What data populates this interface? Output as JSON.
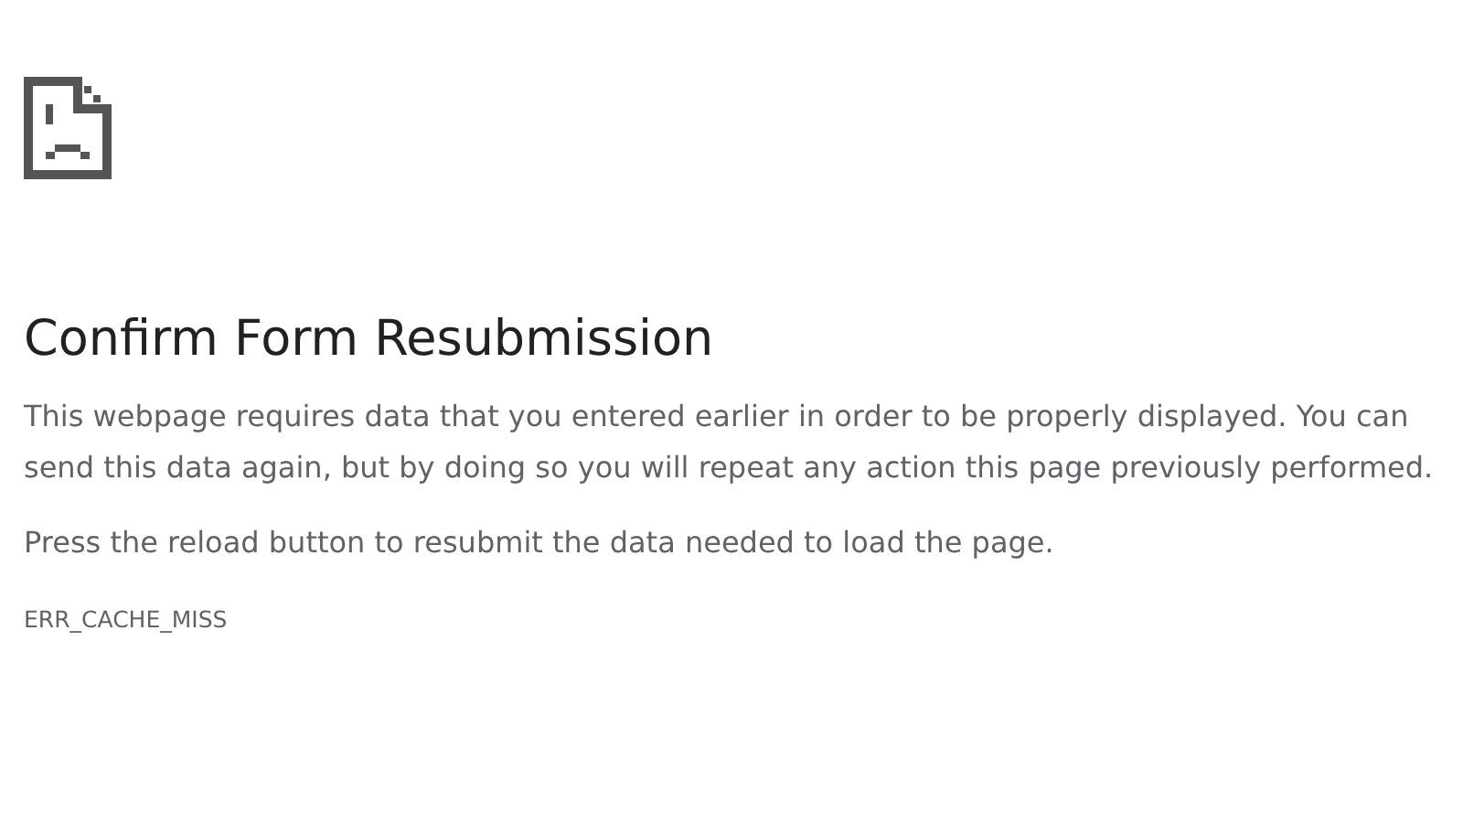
{
  "heading": "Confirm Form Resubmission",
  "paragraphs": [
    "This webpage requires data that you entered earlier in order to be properly displayed. You can send this data again, but by doing so you will repeat any action this page previously performed.",
    "Press the reload button to resubmit the data needed to load the page."
  ],
  "error_code": "ERR_CACHE_MISS"
}
